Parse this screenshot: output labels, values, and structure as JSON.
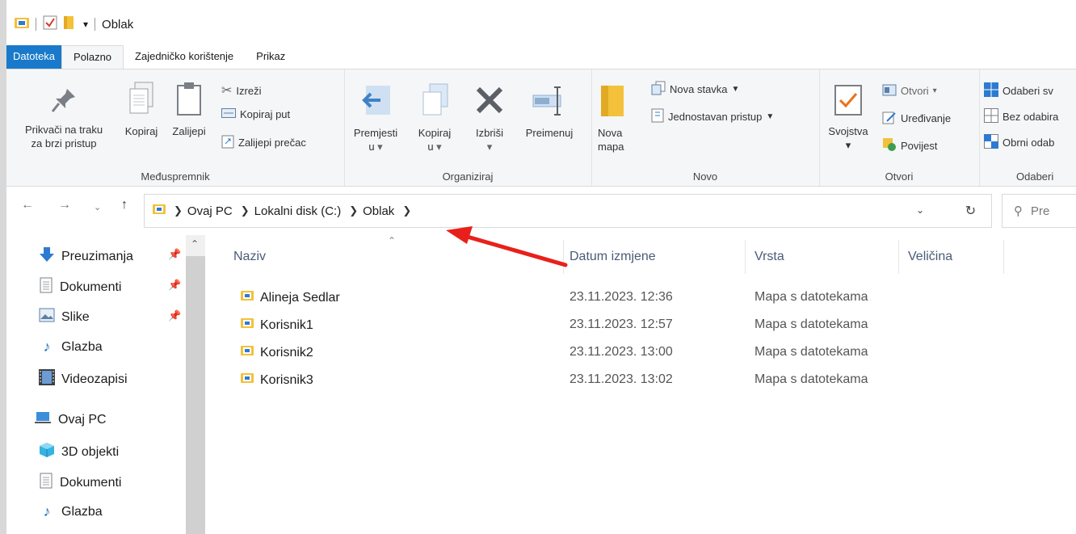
{
  "window": {
    "title": "Oblak"
  },
  "ribbon_tabs": [
    "Datoteka",
    "Polazno",
    "Zajedničko korištenje",
    "Prikaz"
  ],
  "ribbon": {
    "clipboard": {
      "pin": "Prikvači na traku za brzi pristup",
      "pin_line1": "Prikvači na traku",
      "pin_line2": "za brzi pristup",
      "copy": "Kopiraj",
      "paste": "Zalijepi",
      "cut": "Izreži",
      "copy_path": "Kopiraj put",
      "paste_shortcut": "Zalijepi prečac",
      "label": "Međuspremnik"
    },
    "organize": {
      "move_line1": "Premjesti",
      "move_line2": "u",
      "copyto_line1": "Kopiraj",
      "copyto_line2": "u",
      "delete": "Izbriši",
      "rename": "Preimenuj",
      "label": "Organiziraj"
    },
    "new": {
      "new_folder_line1": "Nova",
      "new_folder_line2": "mapa",
      "new_item": "Nova stavka",
      "easy_access": "Jednostavan pristup",
      "label": "Novo"
    },
    "open": {
      "properties": "Svojstva",
      "open": "Otvori",
      "edit": "Uređivanje",
      "history": "Povijest",
      "label": "Otvori"
    },
    "select": {
      "select_all": "Odaberi sv",
      "select_none": "Bez odabira",
      "invert": "Obrni odab",
      "label": "Odaberi"
    }
  },
  "address": {
    "crumbs": [
      "Ovaj PC",
      "Lokalni disk (C:)",
      "Oblak"
    ],
    "search_placeholder": "Pre"
  },
  "sidebar": {
    "quick": [
      {
        "label": "Preuzimanja",
        "icon": "download-arrow-icon",
        "pinned": true
      },
      {
        "label": "Dokumenti",
        "icon": "document-icon",
        "pinned": true
      },
      {
        "label": "Slike",
        "icon": "pictures-icon",
        "pinned": true
      },
      {
        "label": "Glazba",
        "icon": "music-note-icon",
        "pinned": false
      },
      {
        "label": "Videozapisi",
        "icon": "video-film-icon",
        "pinned": false
      }
    ],
    "pc_label": "Ovaj PC",
    "pc_items": [
      {
        "label": "3D objekti",
        "icon": "cube-3d-icon"
      },
      {
        "label": "Dokumenti",
        "icon": "document-icon"
      },
      {
        "label": "Glazba",
        "icon": "music-note-icon"
      }
    ]
  },
  "columns": [
    "Naziv",
    "Datum izmjene",
    "Vrsta",
    "Veličina"
  ],
  "files": [
    {
      "name": "Alineja Sedlar",
      "date": "23.11.2023. 12:36",
      "type": "Mapa s datotekama"
    },
    {
      "name": "Korisnik1",
      "date": "23.11.2023. 12:57",
      "type": "Mapa s datotekama"
    },
    {
      "name": "Korisnik2",
      "date": "23.11.2023. 13:00",
      "type": "Mapa s datotekama"
    },
    {
      "name": "Korisnik3",
      "date": "23.11.2023. 13:02",
      "type": "Mapa s datotekama"
    }
  ],
  "colors": {
    "accent": "#1979ca",
    "folder": "#f3c13a",
    "annotation_arrow": "#e8201b"
  }
}
